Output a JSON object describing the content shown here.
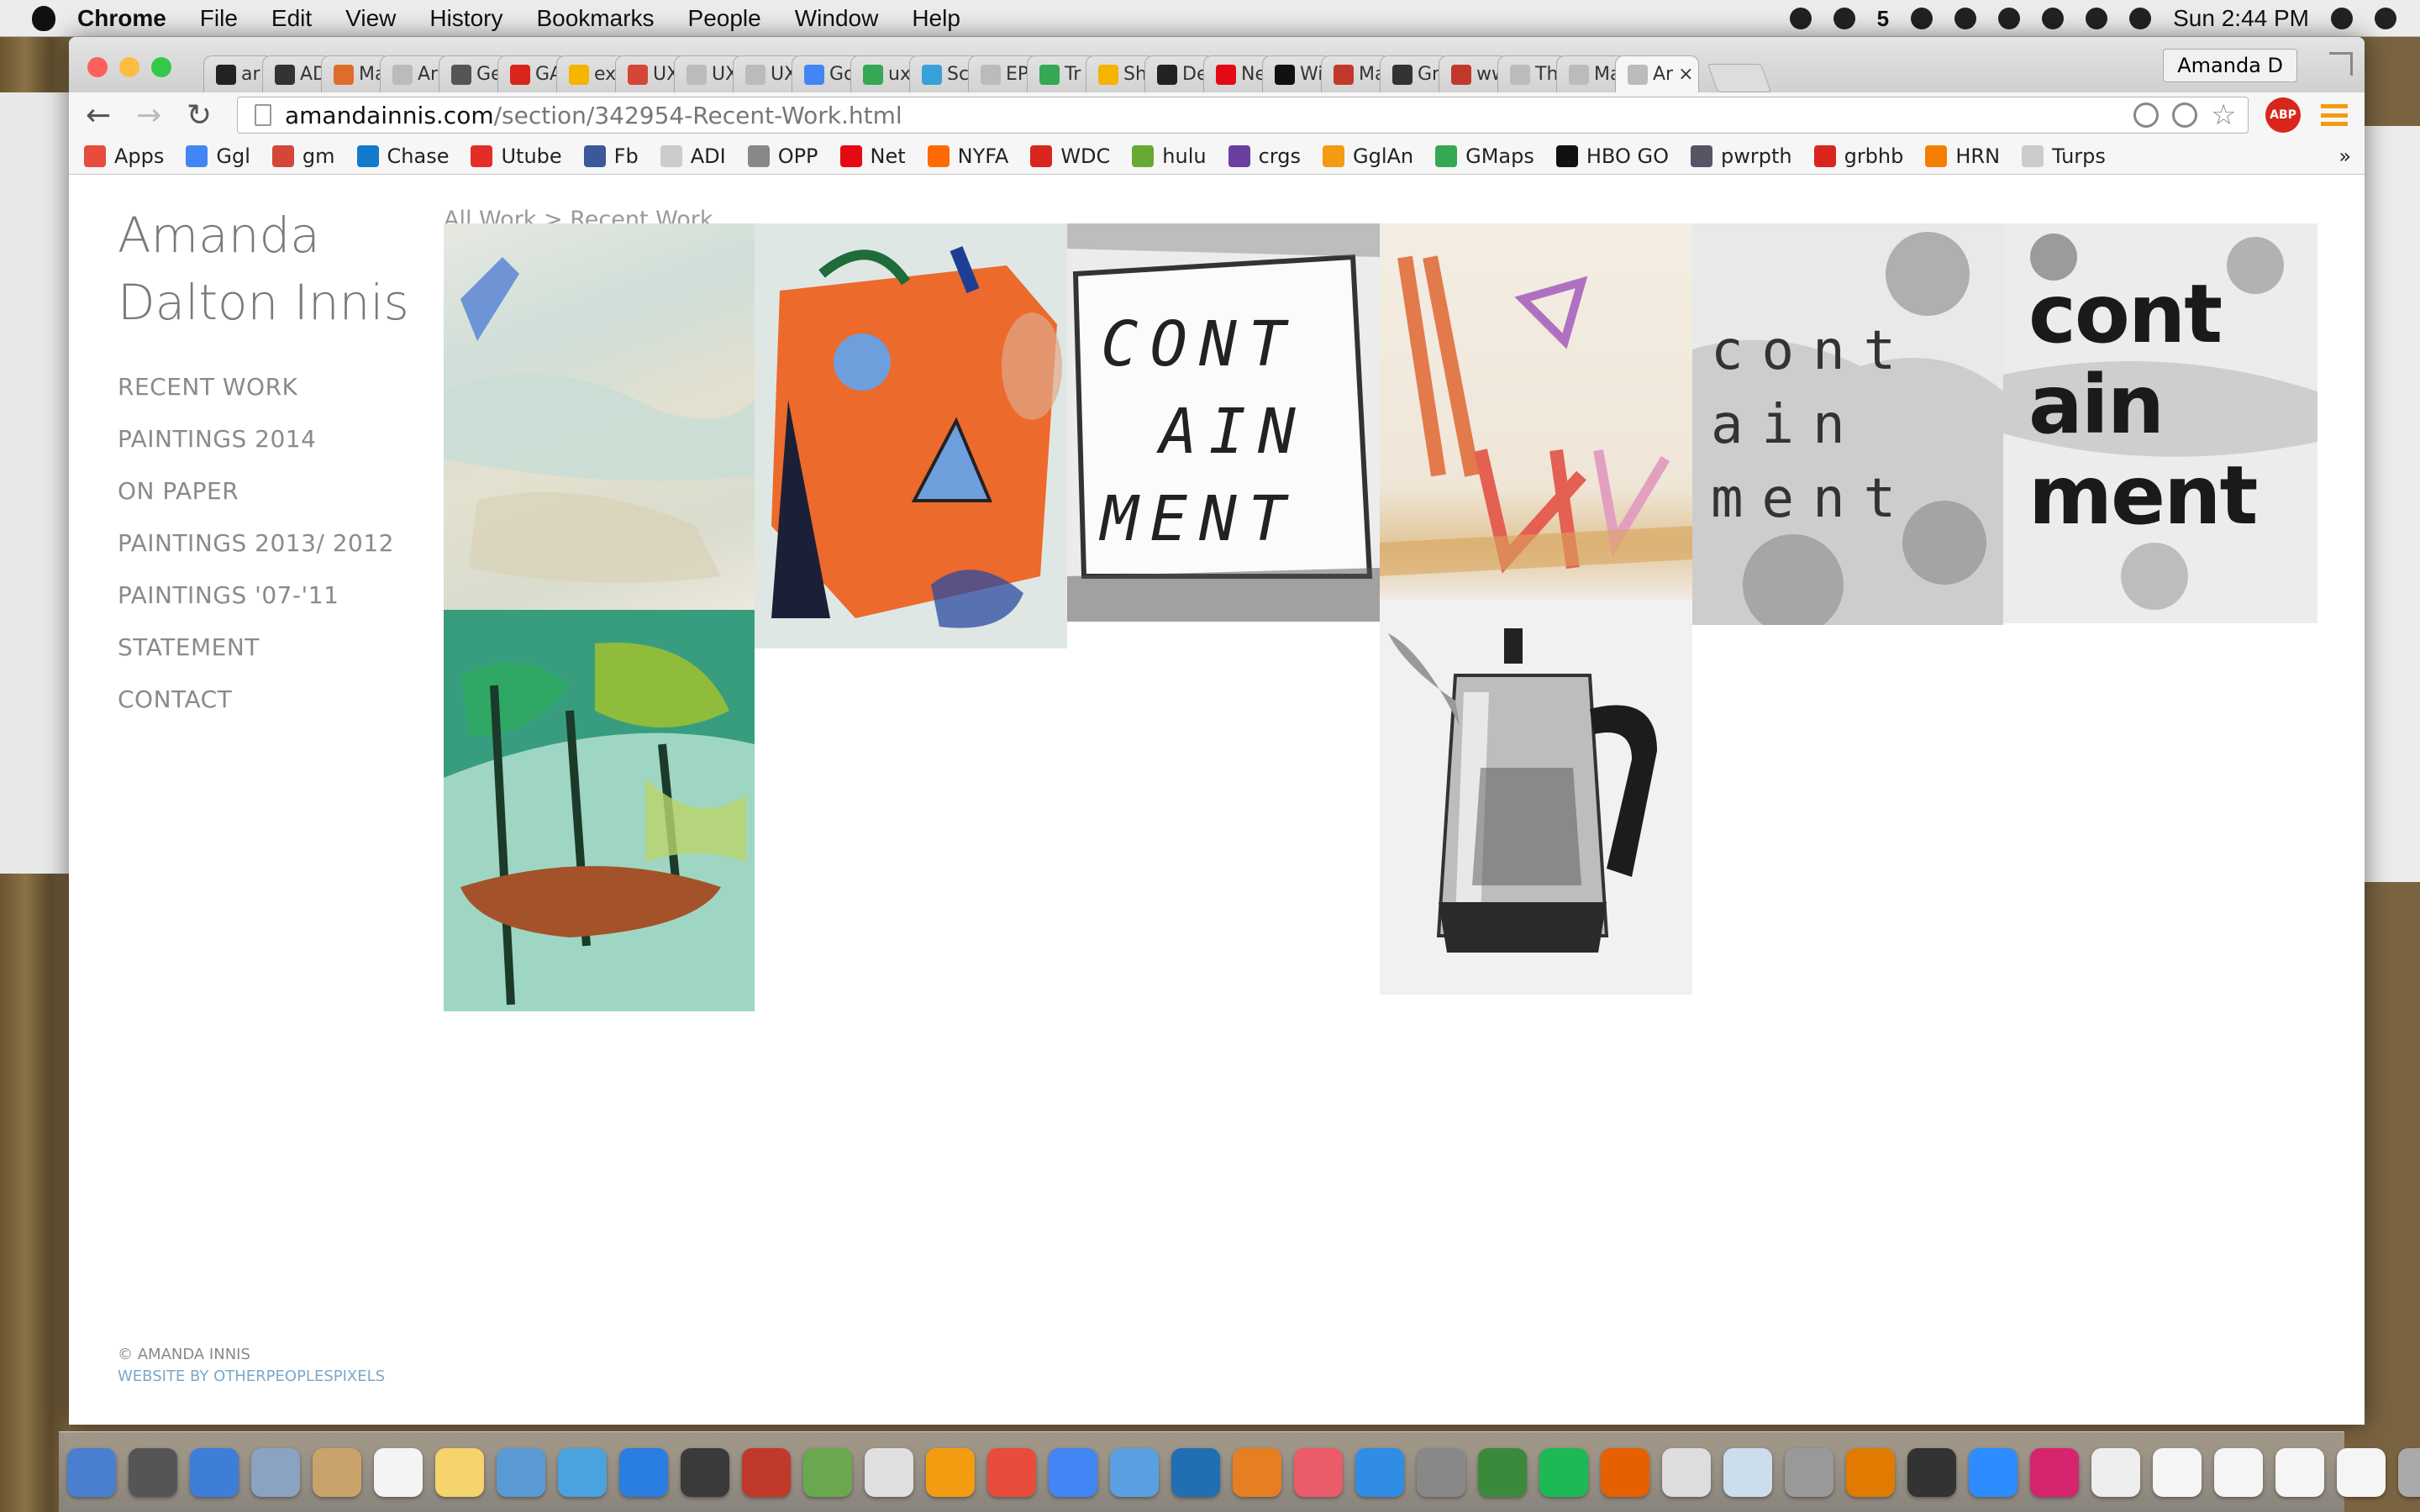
{
  "menubar": {
    "app": "Chrome",
    "items": [
      "File",
      "Edit",
      "View",
      "History",
      "Bookmarks",
      "People",
      "Window",
      "Help"
    ],
    "clock": "Sun 2:44 PM",
    "notif_count": "5"
  },
  "tabs": [
    {
      "label": "ar",
      "color": "#222"
    },
    {
      "label": "AD",
      "color": "#333"
    },
    {
      "label": "Ma",
      "color": "#e06c2a"
    },
    {
      "label": "Ar",
      "color": "#bbb"
    },
    {
      "label": "Ge",
      "color": "#555"
    },
    {
      "label": "GA",
      "color": "#d9261c"
    },
    {
      "label": "ex",
      "color": "#f4b400"
    },
    {
      "label": "UX",
      "color": "#d44638"
    },
    {
      "label": "UX",
      "color": "#bbb"
    },
    {
      "label": "UX",
      "color": "#bbb"
    },
    {
      "label": "Go",
      "color": "#4285f4"
    },
    {
      "label": "ux",
      "color": "#34a853"
    },
    {
      "label": "Sc",
      "color": "#3aa0d8"
    },
    {
      "label": "EP",
      "color": "#bbb"
    },
    {
      "label": "Tr",
      "color": "#34a853"
    },
    {
      "label": "Sh",
      "color": "#f4b400"
    },
    {
      "label": "De",
      "color": "#222"
    },
    {
      "label": "Ne",
      "color": "#e50914"
    },
    {
      "label": "Wi",
      "color": "#111"
    },
    {
      "label": "Ma",
      "color": "#c0392b"
    },
    {
      "label": "Gr",
      "color": "#333"
    },
    {
      "label": "ww",
      "color": "#c0392b"
    },
    {
      "label": "Th",
      "color": "#bbb"
    },
    {
      "label": "Ma",
      "color": "#bbb"
    },
    {
      "label": "Ar",
      "color": "#bbb",
      "active": true
    }
  ],
  "profile": "Amanda D",
  "address": {
    "host": "amandainnis.com",
    "path": "/section/342954-Recent-Work.html"
  },
  "abp": "ABP",
  "bookmarks": [
    {
      "label": "Apps",
      "color": "#e74c3c"
    },
    {
      "label": "Ggl",
      "color": "#4285f4"
    },
    {
      "label": "gm",
      "color": "#d44638"
    },
    {
      "label": "Chase",
      "color": "#117aca"
    },
    {
      "label": "Utube",
      "color": "#e52d27"
    },
    {
      "label": "Fb",
      "color": "#3b5998"
    },
    {
      "label": "ADI",
      "color": "#ccc"
    },
    {
      "label": "OPP",
      "color": "#888"
    },
    {
      "label": "Net",
      "color": "#e50914"
    },
    {
      "label": "NYFA",
      "color": "#ff6a00"
    },
    {
      "label": "WDC",
      "color": "#d9261c"
    },
    {
      "label": "hulu",
      "color": "#66aa33"
    },
    {
      "label": "crgs",
      "color": "#6b3fa0"
    },
    {
      "label": "GglAn",
      "color": "#f39c12"
    },
    {
      "label": "GMaps",
      "color": "#34a853"
    },
    {
      "label": "HBO GO",
      "color": "#111"
    },
    {
      "label": "pwrpth",
      "color": "#556"
    },
    {
      "label": "grbhb",
      "color": "#d9261c"
    },
    {
      "label": "HRN",
      "color": "#f57d00"
    },
    {
      "label": "Turps",
      "color": "#ccc"
    }
  ],
  "site": {
    "name_line1": "Amanda",
    "name_line2": "Dalton Innis",
    "nav": [
      "RECENT WORK",
      "PAINTINGS 2014",
      "ON PAPER",
      "PAINTINGS 2013/ 2012",
      "PAINTINGS '07-'11",
      "STATEMENT",
      "CONTACT"
    ],
    "breadcrumb": {
      "root": "All Work",
      "sep": ">",
      "current": "Recent Work"
    },
    "footer": {
      "copyright": "© AMANDA INNIS",
      "credit": "WEBSITE BY OTHERPEOPLESPIXELS"
    },
    "artworks": [
      {
        "id": "pale-abstract",
        "kind": "pale"
      },
      {
        "id": "orange-face",
        "kind": "orange"
      },
      {
        "id": "containment-1",
        "kind": "text",
        "text": [
          "CONT",
          "AIN",
          "MENT"
        ]
      },
      {
        "id": "pink-lines",
        "kind": "pinklines"
      },
      {
        "id": "containment-2",
        "kind": "text2",
        "text": [
          "cont",
          "ain",
          "ment"
        ]
      },
      {
        "id": "containment-3",
        "kind": "text3",
        "text": [
          "cont",
          "ain",
          "ment"
        ]
      },
      {
        "id": "green-forest",
        "kind": "green"
      },
      {
        "id": "coffee-pot",
        "kind": "pot"
      }
    ]
  },
  "colors": {
    "accent": "#f39c12",
    "link": "#7ba7c9",
    "text": "#8a8a8a"
  }
}
